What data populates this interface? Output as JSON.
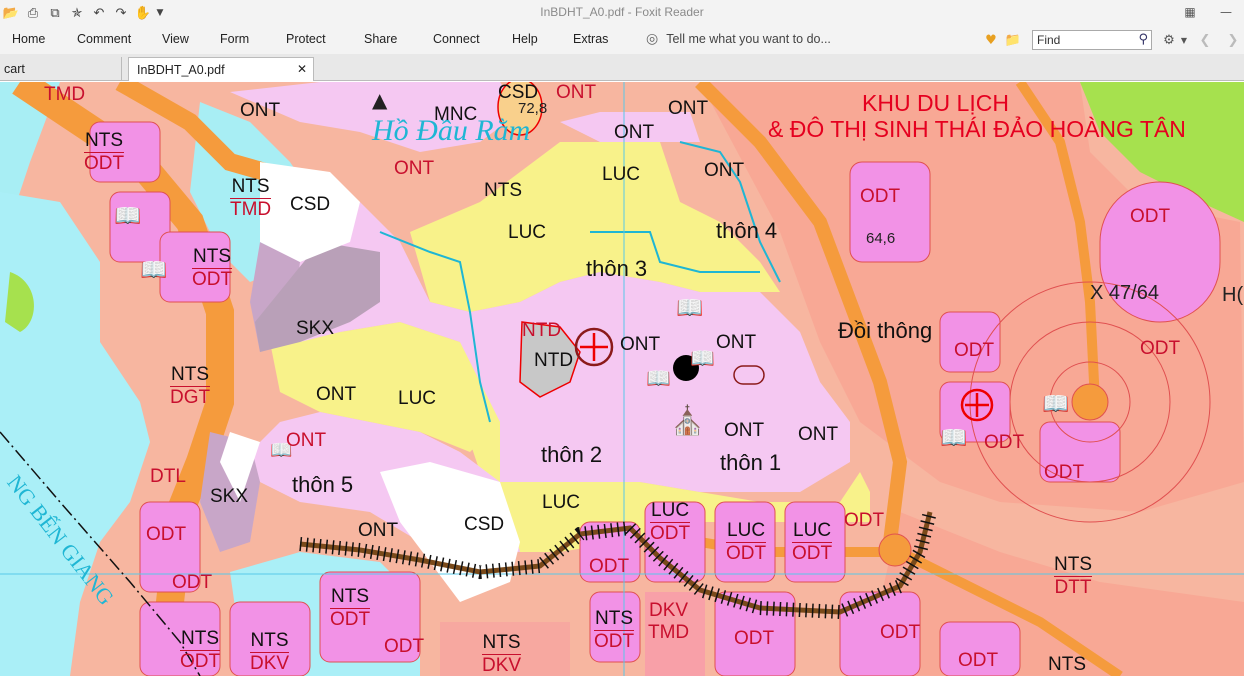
{
  "window": {
    "title": "InBDHT_A0.pdf - Foxit Reader"
  },
  "menu": {
    "items": [
      "Home",
      "Comment",
      "View",
      "Form",
      "Protect",
      "Share",
      "Connect",
      "Help",
      "Extras"
    ],
    "tell_me": "Tell me what you want to do..."
  },
  "search": {
    "placeholder": "Find"
  },
  "tabs": {
    "tab1": "cart",
    "tab2": "InBDHT_A0.pdf"
  },
  "map": {
    "zone_title_line1": "KHU DU LỊCH",
    "zone_title_line2": "& ĐÔ THỊ SINH THÁI ĐẢO HOÀNG TÂN",
    "river_lake": "Hồ Đầu Rằm",
    "river_left": "NG BẾN GIANG",
    "places": {
      "thon1": "thôn 1",
      "thon2": "thôn 2",
      "thon3": "thôn 3",
      "thon4": "thôn 4",
      "thon5": "thôn 5",
      "doi_thong": "Đồi thông"
    },
    "elevations": {
      "e1": "72,8",
      "e2": "64,6",
      "e3": "X 47/64",
      "edge": "H("
    },
    "codes": {
      "tmd_tl": "TMD",
      "ont_top1": "ONT",
      "mnc": "MNC",
      "csd_top": "CSD",
      "ont_top2": "ONT",
      "ont_top3": "ONT",
      "ont_a": "ONT",
      "nts_odt_1a": "NTS",
      "nts_odt_1b": "ODT",
      "nts_tmd_a": "NTS",
      "nts_tmd_b": "TMD",
      "csd_left": "CSD",
      "ont_b": "ONT",
      "nts_mid": "NTS",
      "luc_a": "LUC",
      "luc_b": "LUC",
      "ont_c": "ONT",
      "nts_odt_2a": "NTS",
      "nts_odt_2b": "ODT",
      "skx_a": "SKX",
      "ntd_a": "NTD",
      "ntd_b": "NTD",
      "ont_d": "ONT",
      "ont_e": "ONT",
      "nts_dgt_a": "NTS",
      "nts_dgt_b": "DGT",
      "ont_f": "ONT",
      "luc_c": "LUC",
      "ont_g": "ONT",
      "ont_h": "ONT",
      "ont_i": "ONT",
      "dtl": "DTL",
      "skx_b": "SKX",
      "luc_d": "LUC",
      "ont_j": "ONT",
      "csd_b": "CSD",
      "odt_l1": "ODT",
      "odt_l2": "ODT",
      "nts_odt_3a": "NTS",
      "nts_odt_3b": "ODT",
      "nts_odt_4a": "NTS",
      "nts_odt_4b": "ODT",
      "nts_dkv_a": "NTS",
      "nts_dkv_b": "DKV",
      "odt_b1": "ODT",
      "nts_dkv2_a": "NTS",
      "nts_dkv2_b": "DKV",
      "odt_r1": "ODT",
      "odt_r2": "ODT",
      "odt_r3": "ODT",
      "odt_r4": "ODT",
      "odt_r5": "ODT",
      "odt_r6": "ODT",
      "luc_odt_1a": "LUC",
      "luc_odt_1b": "ODT",
      "luc_odt_2a": "LUC",
      "luc_odt_2b": "ODT",
      "luc_odt_3a": "LUC",
      "luc_odt_3b": "ODT",
      "odt_s1": "ODT",
      "nts_odt_5a": "NTS",
      "nts_odt_5b": "ODT",
      "dkv_tmd_a": "DKV",
      "dkv_tmd_b": "TMD",
      "odt_s2": "ODT",
      "odt_s3": "ODT",
      "odt_s4": "ODT",
      "odt_s5": "ODT",
      "nts_dtt_a": "NTS",
      "nts_dtt_b": "DTT",
      "nts_br": "NTS"
    }
  }
}
